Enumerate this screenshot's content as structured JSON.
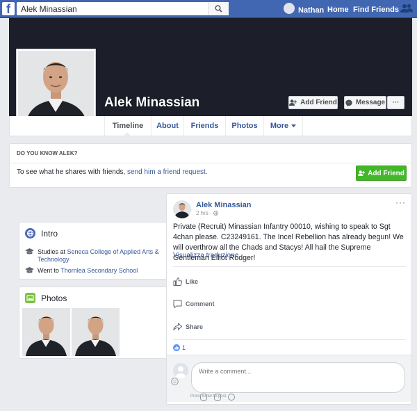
{
  "topbar": {
    "logo": "f",
    "search_value": "Alek Minassian",
    "search_icon": "search-icon",
    "user_name": "Nathan",
    "home_label": "Home",
    "find_friends_label": "Find Friends",
    "friend_requests_icon": "friends-icon"
  },
  "profile": {
    "name": "Alek Minassian",
    "add_friend_label": "Add Friend",
    "message_label": "Message",
    "more_dots": "···"
  },
  "tabs": [
    {
      "label": "Timeline",
      "active": true
    },
    {
      "label": "About"
    },
    {
      "label": "Friends"
    },
    {
      "label": "Photos"
    },
    {
      "label": "More"
    }
  ],
  "know": {
    "title": "DO YOU KNOW ALEK?",
    "text_prefix": "To see what he shares with friends,",
    "link": "send him a friend request.",
    "button": "Add Friend"
  },
  "intro": {
    "title": "Intro",
    "studies_prefix": "Studies at",
    "studies_place": "Seneca College of Applied Arts & Technology",
    "went_prefix": "Went to",
    "went_place": "Thornlea Secondary School"
  },
  "photos": {
    "title": "Photos"
  },
  "post": {
    "author": "Alek Minassian",
    "time": "2 hrs ·",
    "menu": "···",
    "text": "Private (Recruit) Minassian Infantry 00010, wishing to speak to Sgt 4chan please. C23249161. The Incel Rebellion has already begun! We will overthrow all the Chads and Stacys! All hail the Supreme Gentleman Elliot Rodger!",
    "translate": "Visualizza traduzione",
    "like": "Like",
    "comment": "Comment",
    "share": "Share",
    "like_count": "1",
    "comment_placeholder": "Write a comment...",
    "press_hint": "Press Enter to post."
  },
  "colors": {
    "brand": "#4267b2",
    "link": "#365899",
    "green": "#42b72a",
    "cover": "#1c1e29"
  }
}
